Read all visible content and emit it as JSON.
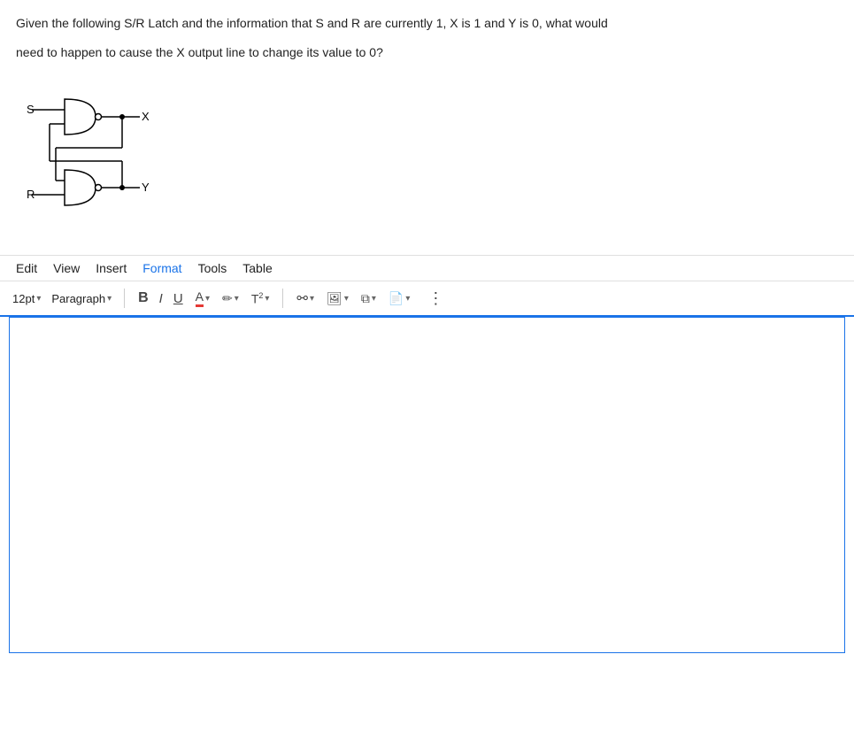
{
  "question": {
    "text_line1": "Given the following S/R Latch and the information that S and R are currently 1, X is 1 and Y is 0, what would",
    "text_line2": "need to happen to cause the X output line to change its value to 0?"
  },
  "menu": {
    "edit": "Edit",
    "view": "View",
    "insert": "Insert",
    "format": "Format",
    "tools": "Tools",
    "table": "Table"
  },
  "toolbar": {
    "font_size": "12pt",
    "paragraph": "Paragraph",
    "bold": "B",
    "italic": "I",
    "underline": "U",
    "font_color": "A",
    "highlight": "✏",
    "superscript": "T²",
    "link": "🔗",
    "image": "🖼",
    "copy_format": "⧉",
    "insert_special": "📄",
    "more": "⋮"
  }
}
